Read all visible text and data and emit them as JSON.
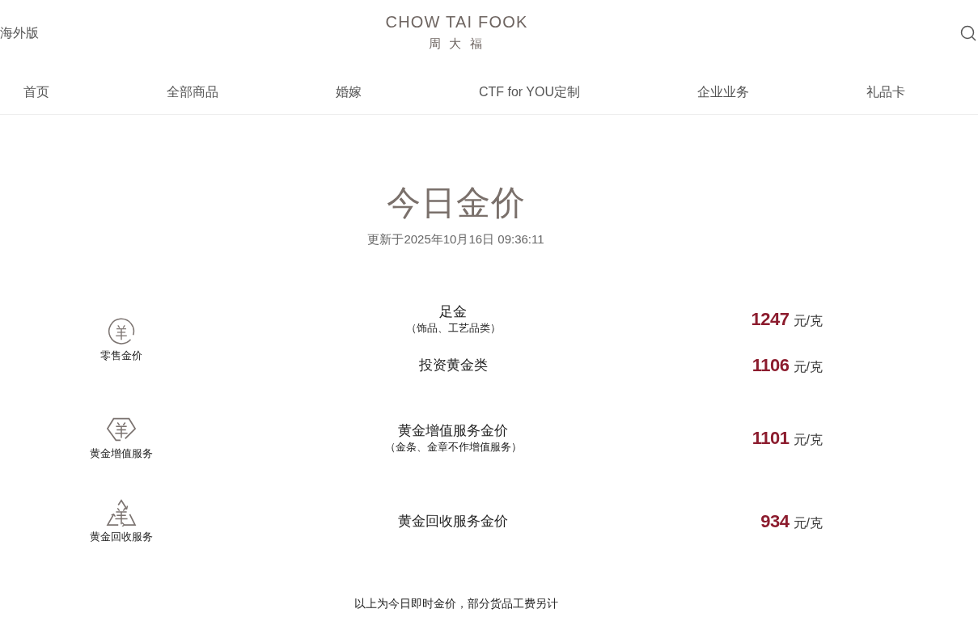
{
  "header": {
    "region_link": "海外版",
    "logo": {
      "wordmark": "CHOW TAI FOOK",
      "chinese": "周 大 福"
    }
  },
  "nav": [
    {
      "label": "首页"
    },
    {
      "label": "全部商品"
    },
    {
      "label": "婚嫁"
    },
    {
      "label": "CTF for YOU定制"
    },
    {
      "label": "企业业务"
    },
    {
      "label": "礼品卡"
    }
  ],
  "page_title": "今日金价",
  "updated": "更新于2025年10月16日 09:36:11",
  "groups": [
    {
      "kind": "retail",
      "label": "零售金价",
      "rows": [
        {
          "name": "足金",
          "note": "（饰品、工艺品类）",
          "price": "1247",
          "unit": "元/克"
        },
        {
          "name": "投资黄金类",
          "price": "1106",
          "unit": "元/克"
        }
      ]
    },
    {
      "kind": "appreciation",
      "label": "黄金增值服务",
      "rows": [
        {
          "name": "黄金增值服务金价",
          "note": "（金条、金章不作增值服务）",
          "price": "1101",
          "unit": "元/克"
        }
      ]
    },
    {
      "kind": "recycling",
      "label": "黄金回收服务",
      "rows": [
        {
          "name": "黄金回收服务金价",
          "price": "934",
          "unit": "元/克"
        }
      ]
    }
  ],
  "footnote": "以上为今日即时金价，部分货品工费另计"
}
